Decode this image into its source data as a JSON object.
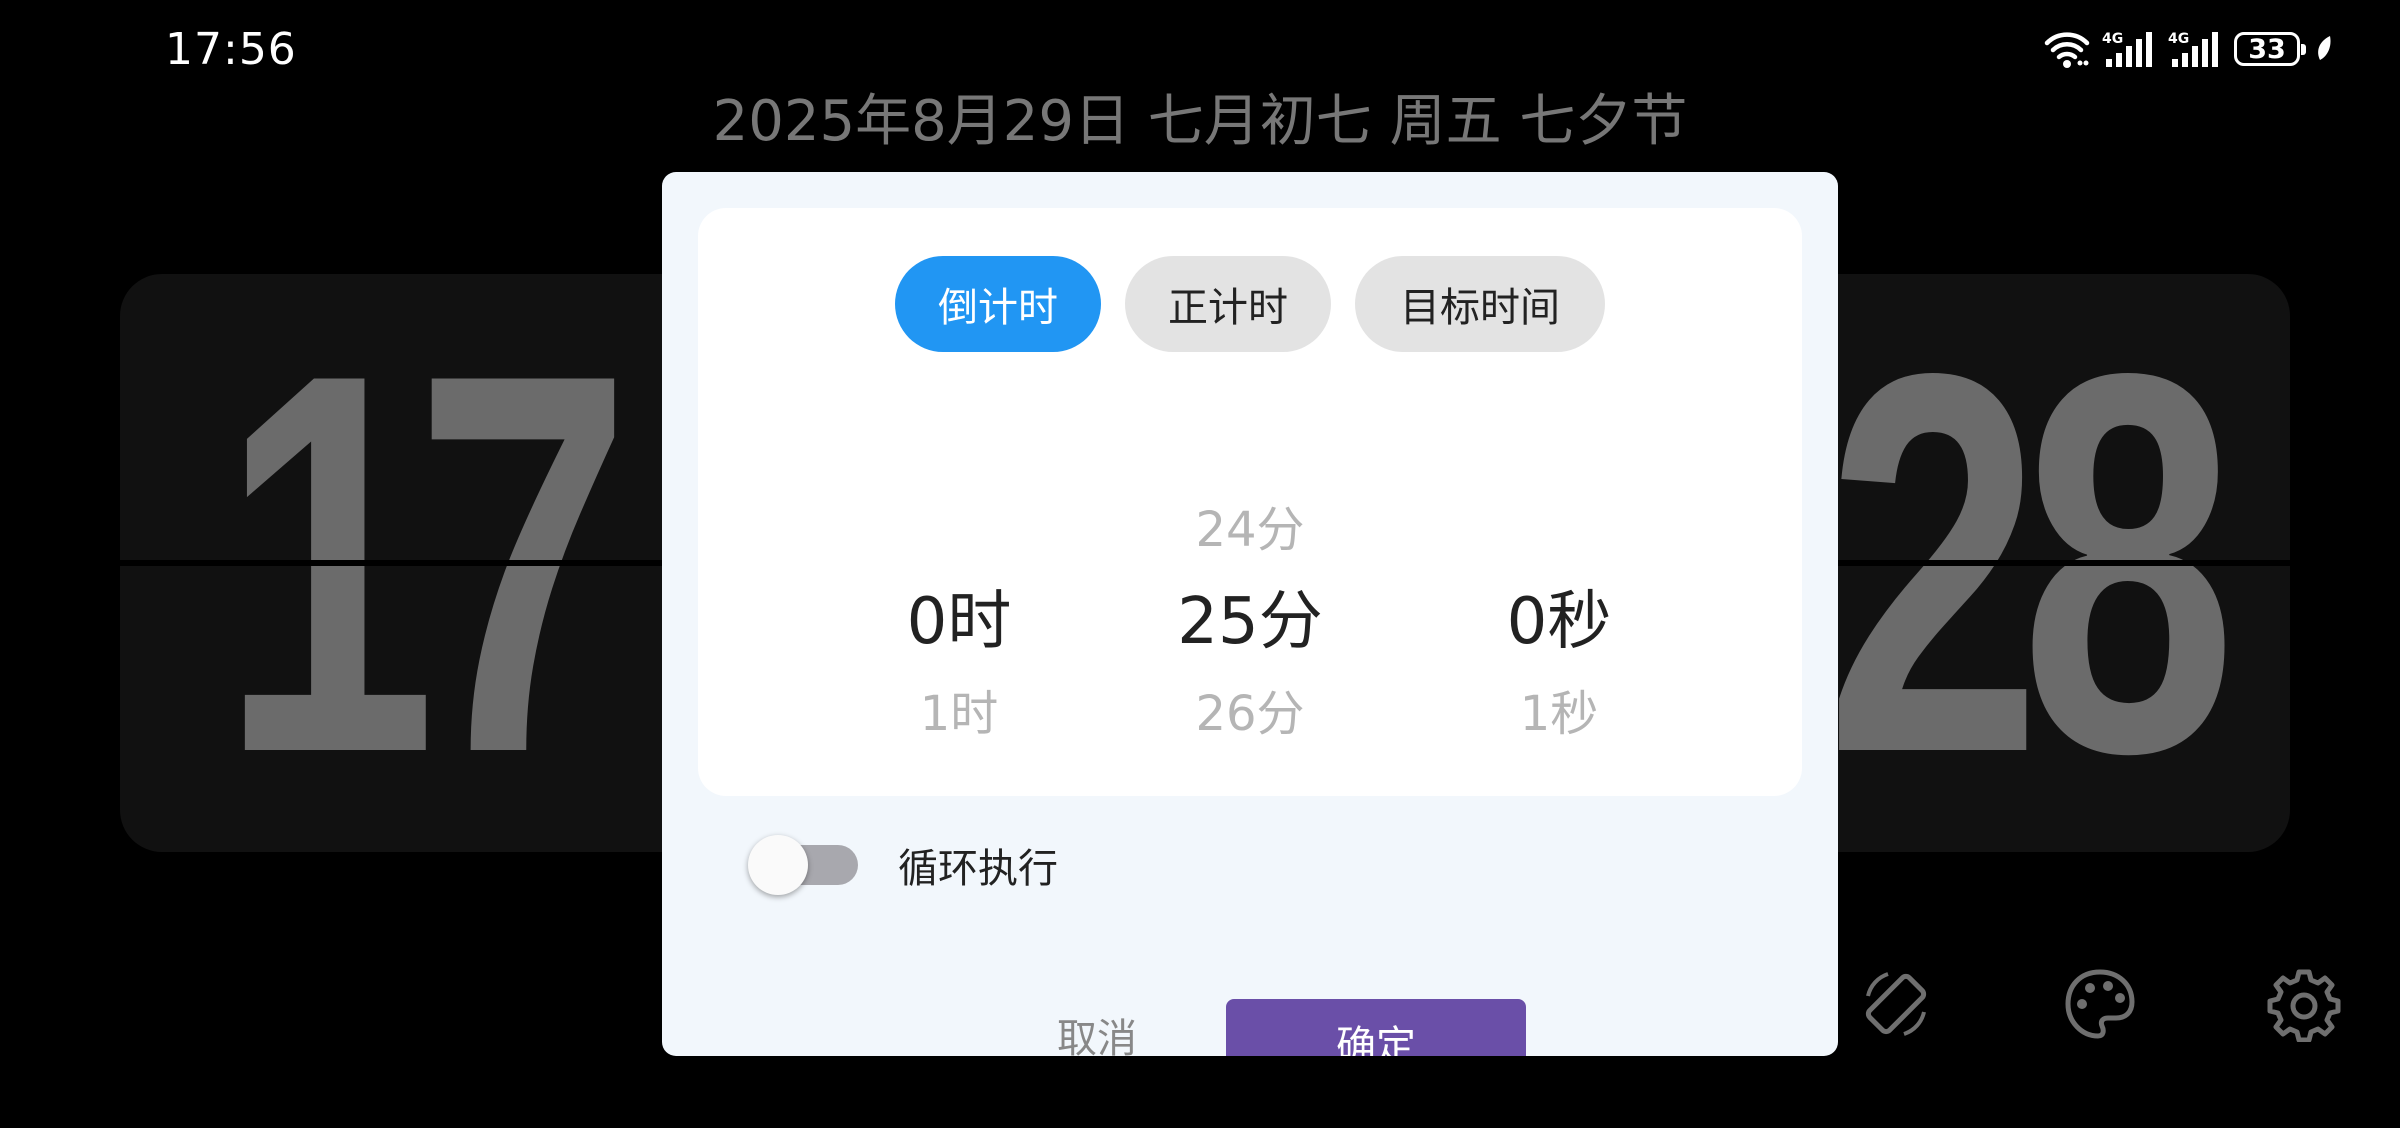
{
  "status_bar": {
    "time": "17:56",
    "network_1": "4G",
    "network_2": "4G",
    "battery": "33"
  },
  "date_line": "2025年8月29日 七月初七 周五 七夕节",
  "flip_clock": {
    "hours": "17",
    "minutes": "28"
  },
  "dialog": {
    "tabs": [
      {
        "label": "倒计时",
        "active": true
      },
      {
        "label": "正计时",
        "active": false
      },
      {
        "label": "目标时间",
        "active": false
      }
    ],
    "hours_wheel": {
      "prev": "",
      "selected": "0时",
      "next": "1时"
    },
    "minutes_wheel": {
      "prev": "24分",
      "selected": "25分",
      "next": "26分"
    },
    "seconds_wheel": {
      "prev": "",
      "selected": "0秒",
      "next": "1秒"
    },
    "loop_toggle": {
      "label": "循环执行",
      "on": false
    },
    "cancel_label": "取消",
    "confirm_label": "确定"
  },
  "controls": {
    "icons": [
      "rotate-screen-icon",
      "palette-icon",
      "gear-icon"
    ]
  },
  "colors": {
    "accent_tab": "#2196f3",
    "confirm_button": "#6a4fa8",
    "dialog_bg": "#f2f7fc"
  }
}
